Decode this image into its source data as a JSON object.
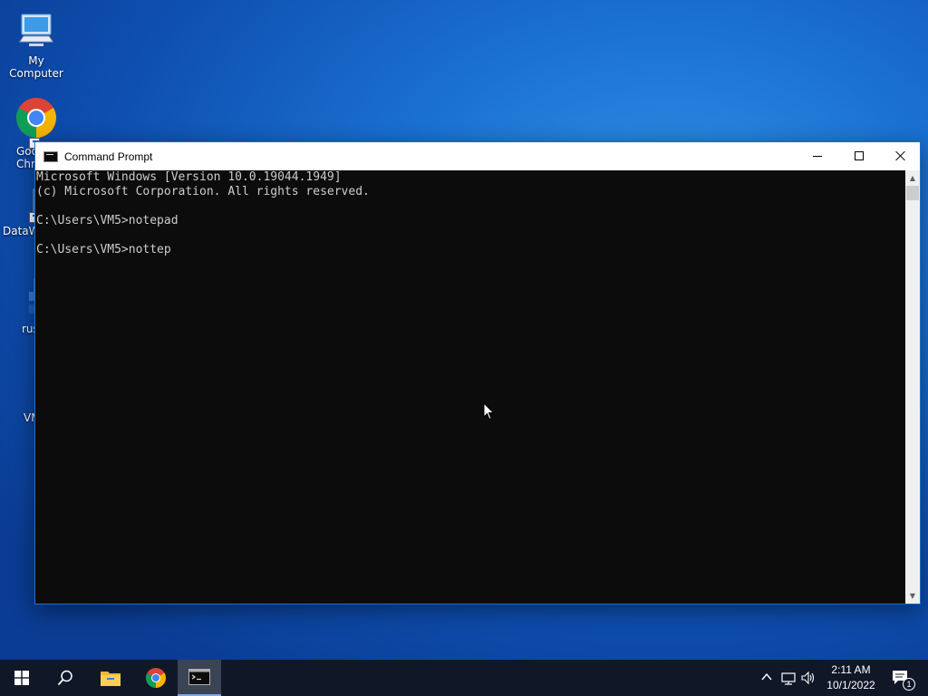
{
  "desktop": {
    "icons": [
      {
        "label": "My Computer"
      },
      {
        "label": "Goo\nChr"
      },
      {
        "label": "DataW"
      },
      {
        "label": "rus"
      },
      {
        "label": "VM"
      }
    ]
  },
  "window": {
    "title": "Command Prompt",
    "console_text": "Microsoft Windows [Version 10.0.19044.1949]\n(c) Microsoft Corporation. All rights reserved.\n\nC:\\Users\\VM5>notepad\n\nC:\\Users\\VM5>nottep"
  },
  "taskbar": {
    "clock_time": "2:11 AM",
    "clock_date": "10/1/2022",
    "notification_count": "1"
  },
  "colors": {
    "console_bg": "#0c0c0c",
    "console_fg": "#cccccc",
    "taskbar_bg": "#101828"
  }
}
